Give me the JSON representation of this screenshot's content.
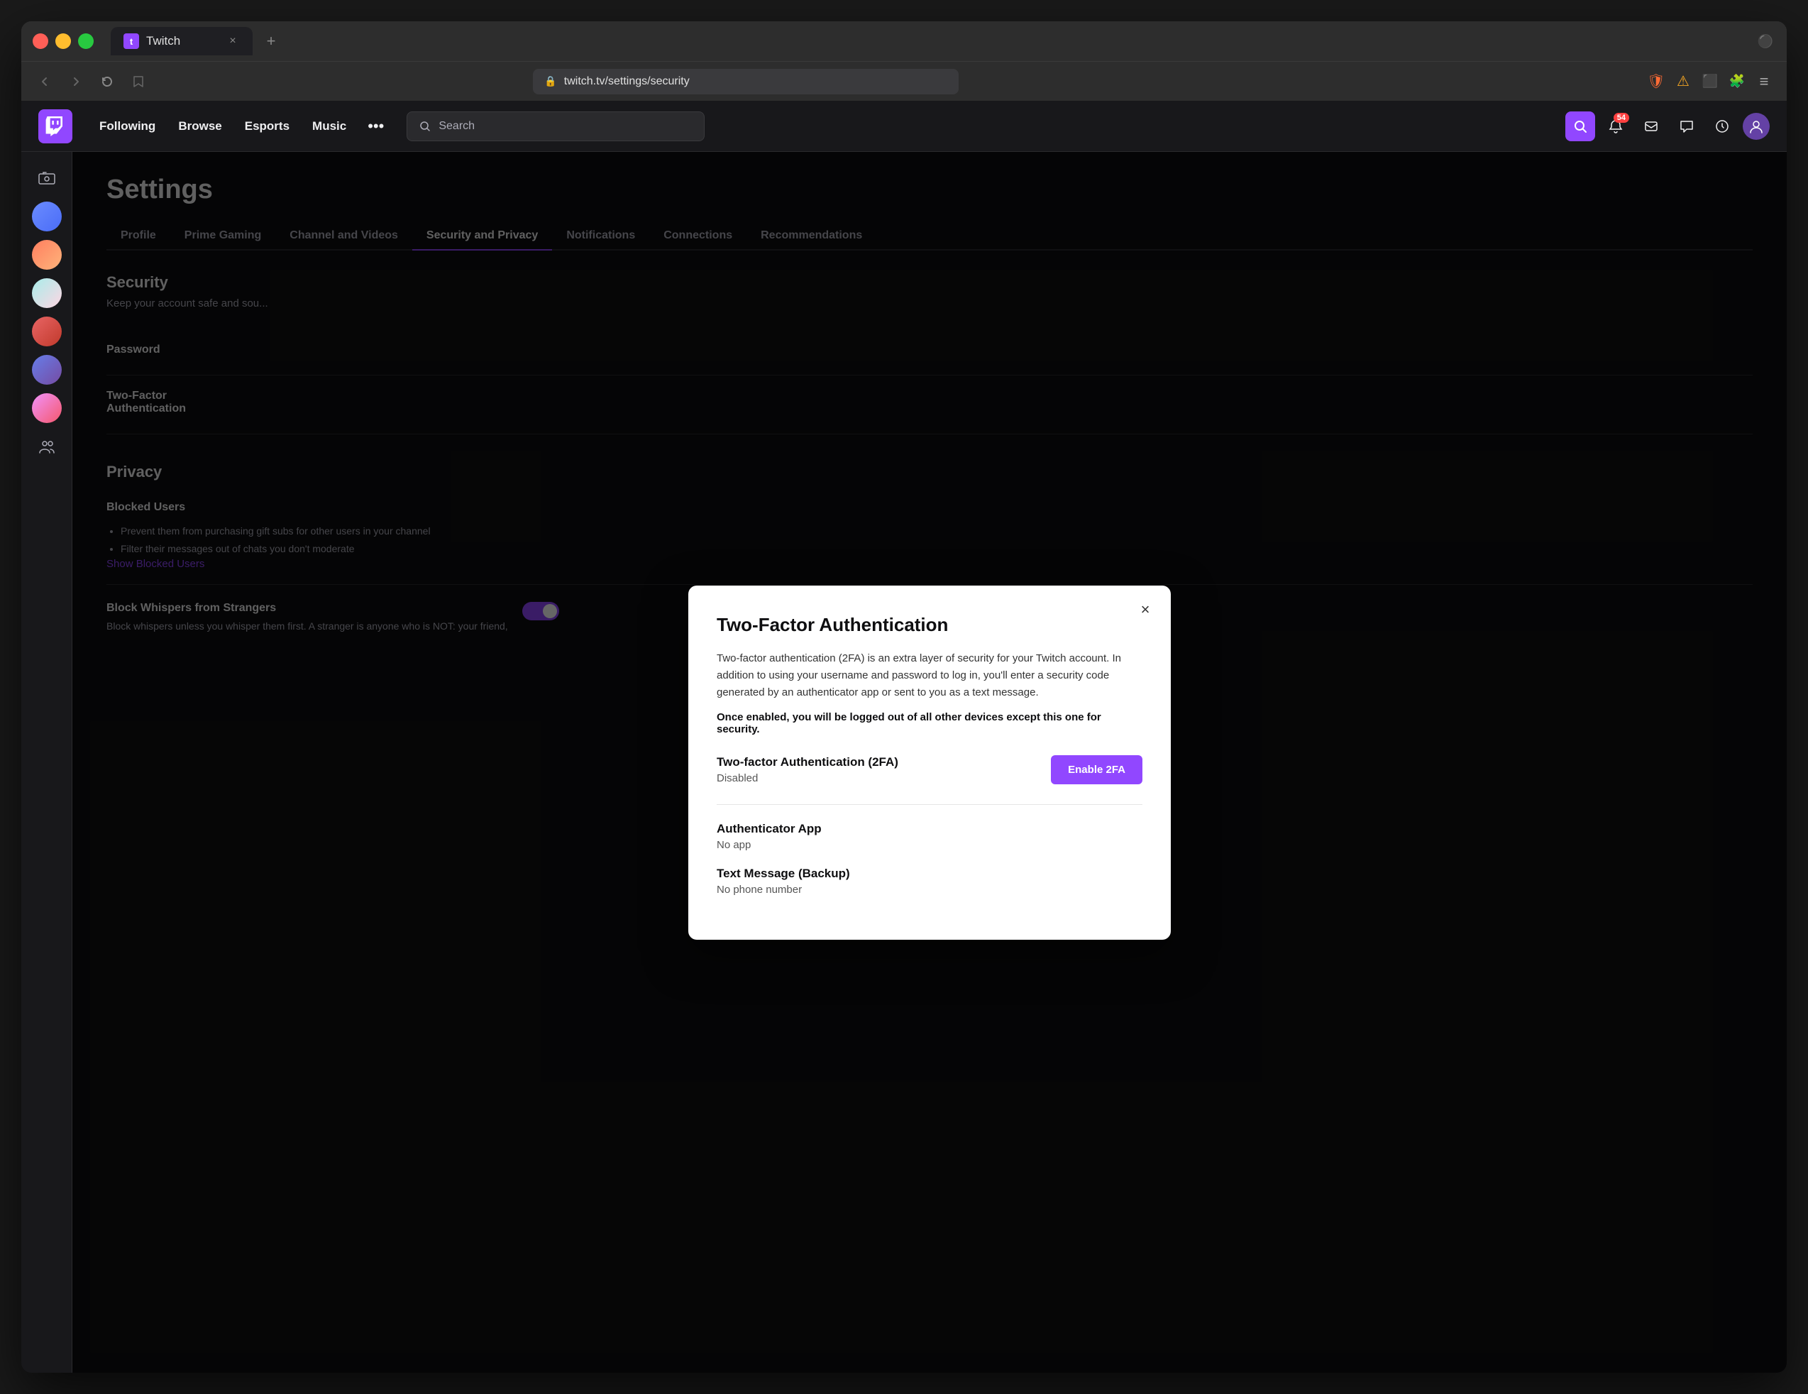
{
  "browser": {
    "tab_title": "Twitch",
    "tab_close_label": "×",
    "tab_new_label": "+",
    "address": "twitch.tv/settings/security",
    "nav_back_label": "‹",
    "nav_forward_label": "›",
    "nav_refresh_label": "↺"
  },
  "twitch_nav": {
    "logo_alt": "Twitch Logo",
    "links": [
      {
        "label": "Following"
      },
      {
        "label": "Browse"
      },
      {
        "label": "Esports"
      },
      {
        "label": "Music"
      }
    ],
    "more_label": "•••",
    "search_placeholder": "Search",
    "notifications_badge": "54",
    "icons": [
      "inbox",
      "chat",
      "bell",
      "avatar"
    ]
  },
  "sidebar": {
    "icons": [
      "camera",
      "avatar1",
      "avatar2",
      "avatar3",
      "avatar4",
      "avatar5",
      "avatar6",
      "people"
    ]
  },
  "settings_page": {
    "title": "Settings",
    "tabs": [
      {
        "label": "Profile"
      },
      {
        "label": "Prime Gaming"
      },
      {
        "label": "Channel and Videos"
      },
      {
        "label": "Security and Privacy",
        "active": true
      },
      {
        "label": "Notifications"
      },
      {
        "label": "Connections"
      },
      {
        "label": "Recommendations"
      }
    ],
    "security_section": {
      "title": "Security",
      "description": "Keep your account safe and sou..."
    },
    "items": [
      {
        "title": "Password"
      },
      {
        "title": "Two-Factor\nAuthentication"
      }
    ],
    "privacy_section": {
      "title": "Privacy"
    },
    "blocked_users": {
      "title": "Blocked Users",
      "show_link": "Show Blocked Users",
      "bullet1": "Prevent them from purchasing gift subs for other users in your channel",
      "bullet2": "Filter their messages out of chats you don't moderate"
    },
    "block_whispers": {
      "title": "Block Whispers from Strangers",
      "description": "Block whispers unless you whisper them first. A stranger is anyone who is NOT: your friend,"
    }
  },
  "modal": {
    "title": "Two-Factor Authentication",
    "close_label": "×",
    "description": "Two-factor authentication (2FA) is an extra layer of security for your Twitch account. In addition to using your username and password to log in, you'll enter a security code generated by an authenticator app or sent to you as a text message.",
    "warning": "Once enabled, you will be logged out of all other devices except this one for security.",
    "twofa": {
      "title": "Two-factor Authentication (2FA)",
      "status": "Disabled",
      "enable_label": "Enable 2FA"
    },
    "authenticator": {
      "title": "Authenticator App",
      "value": "No app"
    },
    "text_message": {
      "title": "Text Message (Backup)",
      "value": "No phone number"
    }
  }
}
